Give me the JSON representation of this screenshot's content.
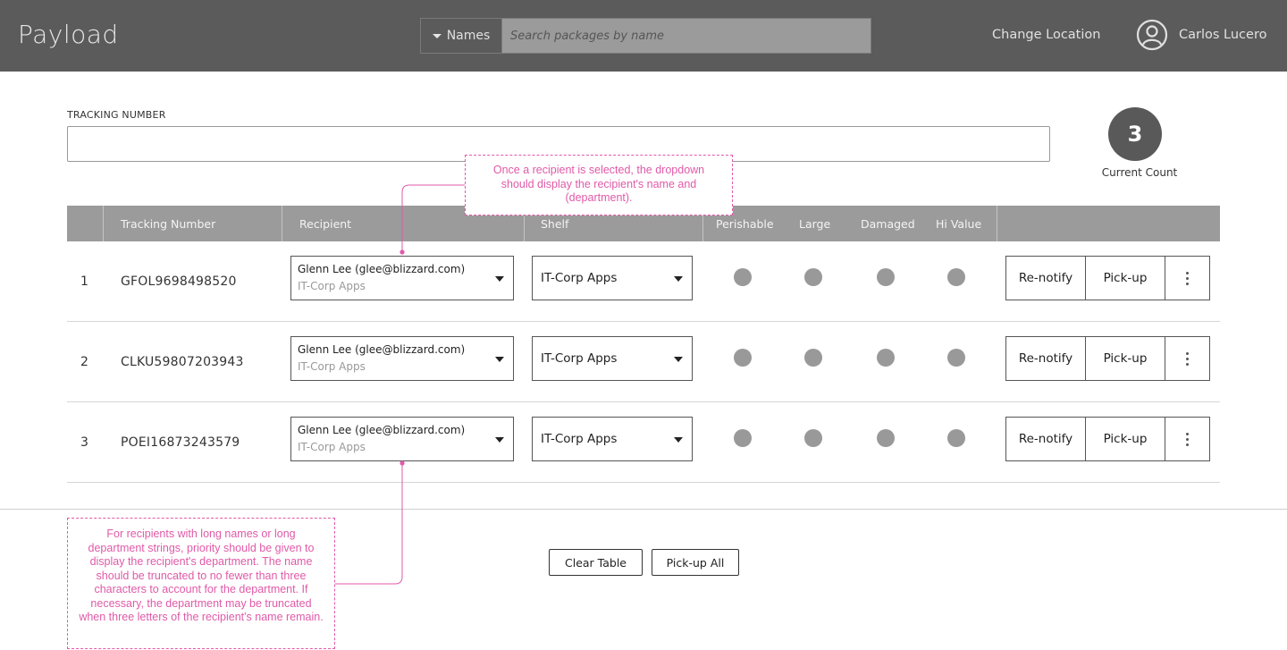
{
  "header": {
    "brand": "Payload",
    "search_type_label": "Names",
    "search_placeholder": "Search packages by name",
    "change_location": "Change Location",
    "user_name": "Carlos Lucero"
  },
  "tracking": {
    "label": "TRACKING NUMBER",
    "value": ""
  },
  "count": {
    "value": "3",
    "label": "Current Count"
  },
  "table": {
    "columns": {
      "tracking": "Tracking Number",
      "recipient": "Recipient",
      "shelf": "Shelf",
      "perishable": "Perishable",
      "large": "Large",
      "damaged": "Damaged",
      "hi_value": "Hi Value"
    },
    "rows": [
      {
        "num": "1",
        "tracking": "GFOL9698498520",
        "recipient_name": "Glenn Lee  (glee@blizzard.com)",
        "recipient_dept": "IT-Corp Apps",
        "shelf": "IT-Corp Apps",
        "renotify": "Re-notify",
        "pickup": "Pick-up"
      },
      {
        "num": "2",
        "tracking": "CLKU59807203943",
        "recipient_name": "Glenn Lee  (glee@blizzard.com)",
        "recipient_dept": "IT-Corp Apps",
        "shelf": "IT-Corp Apps",
        "renotify": "Re-notify",
        "pickup": "Pick-up"
      },
      {
        "num": "3",
        "tracking": "POEI16873243579",
        "recipient_name": "Glenn Lee  (glee@blizzard.com)",
        "recipient_dept": "IT-Corp Apps",
        "shelf": "IT-Corp Apps",
        "renotify": "Re-notify",
        "pickup": "Pick-up"
      }
    ]
  },
  "footer": {
    "clear_table": "Clear Table",
    "pickup_all": "Pick-up All"
  },
  "annotations": {
    "top": "Once a recipient is selected, the dropdown should display the recipient's name and (department).",
    "bottom": "For recipients with long names or long department strings, priority should be given to display the recipient's department. The name should be truncated to no fewer than three characters to account for the department. If necessary, the department may be truncated when three letters of the recipient's name remain."
  },
  "colors": {
    "header_bg": "#5b5b5b",
    "table_header_bg": "#9b9b9b",
    "annotation": "#e05aa8",
    "flag_dot": "#999999"
  }
}
